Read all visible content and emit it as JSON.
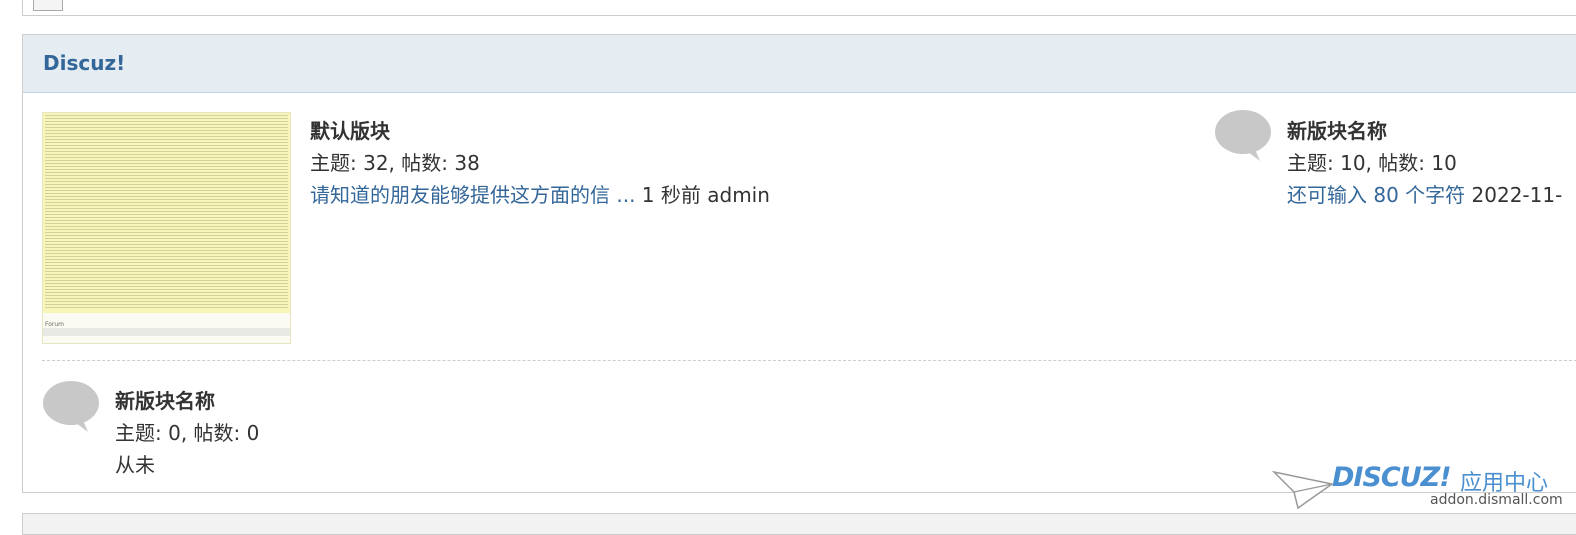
{
  "category": {
    "title": "Discuz!"
  },
  "forums": [
    {
      "name": "默认版块",
      "stats": "主题: 32, 帖数: 38",
      "last_post_link": "请知道的朋友能够提供这方面的信 ...",
      "last_post_time": "1 秒前",
      "last_post_author": "admin",
      "icon": "forum-thumbnail-image"
    },
    {
      "name": "新版块名称",
      "stats": "主题: 10, 帖数: 10",
      "last_post_link": "还可输入 80 个字符",
      "last_post_time": "2022-11-",
      "icon": "speech-bubble-icon"
    },
    {
      "name": "新版块名称",
      "stats": "主题: 0, 帖数: 0",
      "last_post_text": "从未",
      "icon": "speech-bubble-icon"
    }
  ],
  "watermark": {
    "logo": "DISCUZ!",
    "label": "应用中心",
    "url": "addon.dismall.com"
  },
  "colors": {
    "header_bg": "#e5edf2",
    "link": "#336699",
    "icon_gray": "#c8c8c8"
  }
}
